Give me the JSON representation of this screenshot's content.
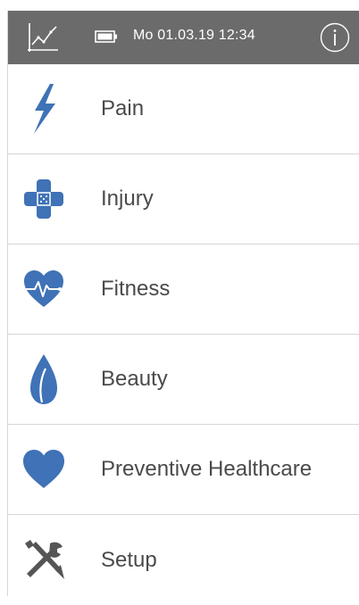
{
  "header": {
    "datetime": "Mo 01.03.19  12:34",
    "icons": {
      "chart": "chart-icon",
      "battery": "battery-icon",
      "info": "info-icon"
    },
    "background_color": "#6b6b6b"
  },
  "menu": {
    "accent_color": "#3f72b6",
    "items": [
      {
        "label": "Pain",
        "icon": "lightning-icon"
      },
      {
        "label": "Injury",
        "icon": "bandage-icon"
      },
      {
        "label": "Fitness",
        "icon": "heartbeat-icon"
      },
      {
        "label": "Beauty",
        "icon": "leaf-icon"
      },
      {
        "label": "Preventive Healthcare",
        "icon": "heart-icon"
      },
      {
        "label": "Setup",
        "icon": "tools-icon"
      }
    ]
  }
}
